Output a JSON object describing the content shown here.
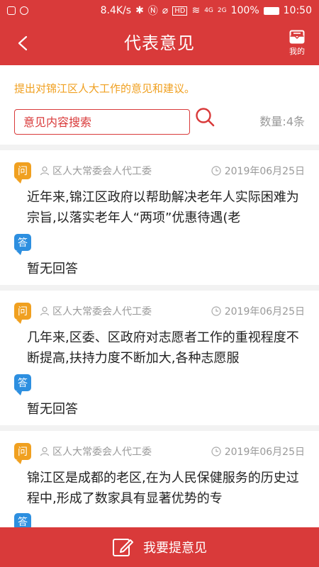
{
  "statusbar": {
    "speed": "8.4K/s",
    "signal1": "4G",
    "signal2": "2G",
    "battery": "100%",
    "time": "10:50"
  },
  "navbar": {
    "title": "代表意见",
    "mine_label": "我的"
  },
  "top": {
    "prompt": "提出对锦江区人大工作的意见和建议。",
    "search_placeholder": "意见内容搜索",
    "count": "数量:4条"
  },
  "cards": [
    {
      "q_badge": "问",
      "user": "区人大常委会人代工委",
      "date": "2019年06月25日",
      "content": "近年来,锦江区政府以帮助解决老年人实际困难为宗旨,以落实老年人“两项”优惠待遇(老",
      "a_badge": "答",
      "answer": "暂无回答"
    },
    {
      "q_badge": "问",
      "user": "区人大常委会人代工委",
      "date": "2019年06月25日",
      "content": "几年来,区委、区政府对志愿者工作的重视程度不断提高,扶持力度不断加大,各种志愿服",
      "a_badge": "答",
      "answer": "暂无回答"
    },
    {
      "q_badge": "问",
      "user": "区人大常委会人代工委",
      "date": "2019年06月25日",
      "content": " 锦江区是成都的老区,在为人民保健服务的历史过程中,形成了数家具有显著优势的专",
      "a_badge": "答",
      "answer": ""
    }
  ],
  "bottom": {
    "label": "我要提意见"
  },
  "colors": {
    "brand_red": "#d93a3a",
    "question_orange": "#f0a020",
    "answer_blue": "#2d8fe0"
  }
}
